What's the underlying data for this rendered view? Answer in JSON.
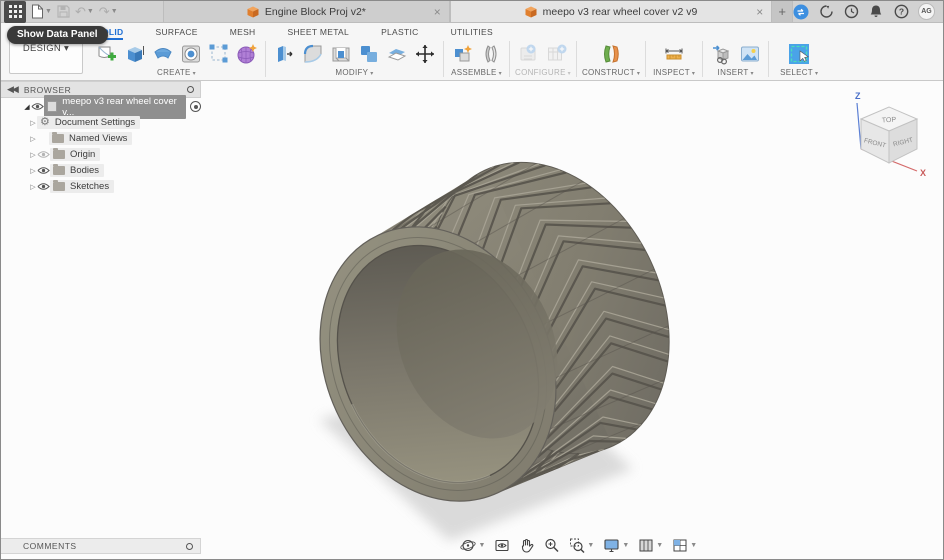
{
  "titlebar": {
    "tabs": [
      {
        "title": "Engine Block Proj v2*"
      },
      {
        "title": "meepo v3 rear wheel cover v2 v9"
      }
    ],
    "new_tab_label": "+",
    "help_label": "?",
    "avatar": "AG"
  },
  "tooltip": {
    "text": "Show Data Panel"
  },
  "ribbon": {
    "design": {
      "label": "DESIGN ▾"
    },
    "tabs": [
      {
        "label": "SOLID"
      },
      {
        "label": "SURFACE"
      },
      {
        "label": "MESH"
      },
      {
        "label": "SHEET METAL"
      },
      {
        "label": "PLASTIC"
      },
      {
        "label": "UTILITIES"
      }
    ],
    "active_tab": "SOLID",
    "groups": [
      {
        "label": "CREATE"
      },
      {
        "label": "MODIFY"
      },
      {
        "label": "ASSEMBLE"
      },
      {
        "label": "CONFIGURE"
      },
      {
        "label": "CONSTRUCT"
      },
      {
        "label": "INSPECT"
      },
      {
        "label": "INSERT"
      },
      {
        "label": "SELECT"
      }
    ]
  },
  "browser": {
    "title": "BROWSER",
    "root_label": "meepo v3 rear wheel cover v...",
    "items": [
      {
        "label": "Document Settings"
      },
      {
        "label": "Named Views"
      },
      {
        "label": "Origin"
      },
      {
        "label": "Bodies"
      },
      {
        "label": "Sketches"
      }
    ]
  },
  "comments": {
    "title": "COMMENTS"
  },
  "viewcube": {
    "faces": {
      "top": "TOP",
      "front": "FRONT",
      "right": "RIGHT"
    },
    "axes": {
      "z": "Z",
      "x": "X"
    }
  },
  "colors": {
    "accent_blue": "#1f6fd4",
    "selection_blue": "#4aa3e8",
    "tire_base": "#847f72",
    "tire_groove": "#56534b",
    "tire_highlight": "#a8a496",
    "viewport_bg": "#fcfcfc"
  }
}
